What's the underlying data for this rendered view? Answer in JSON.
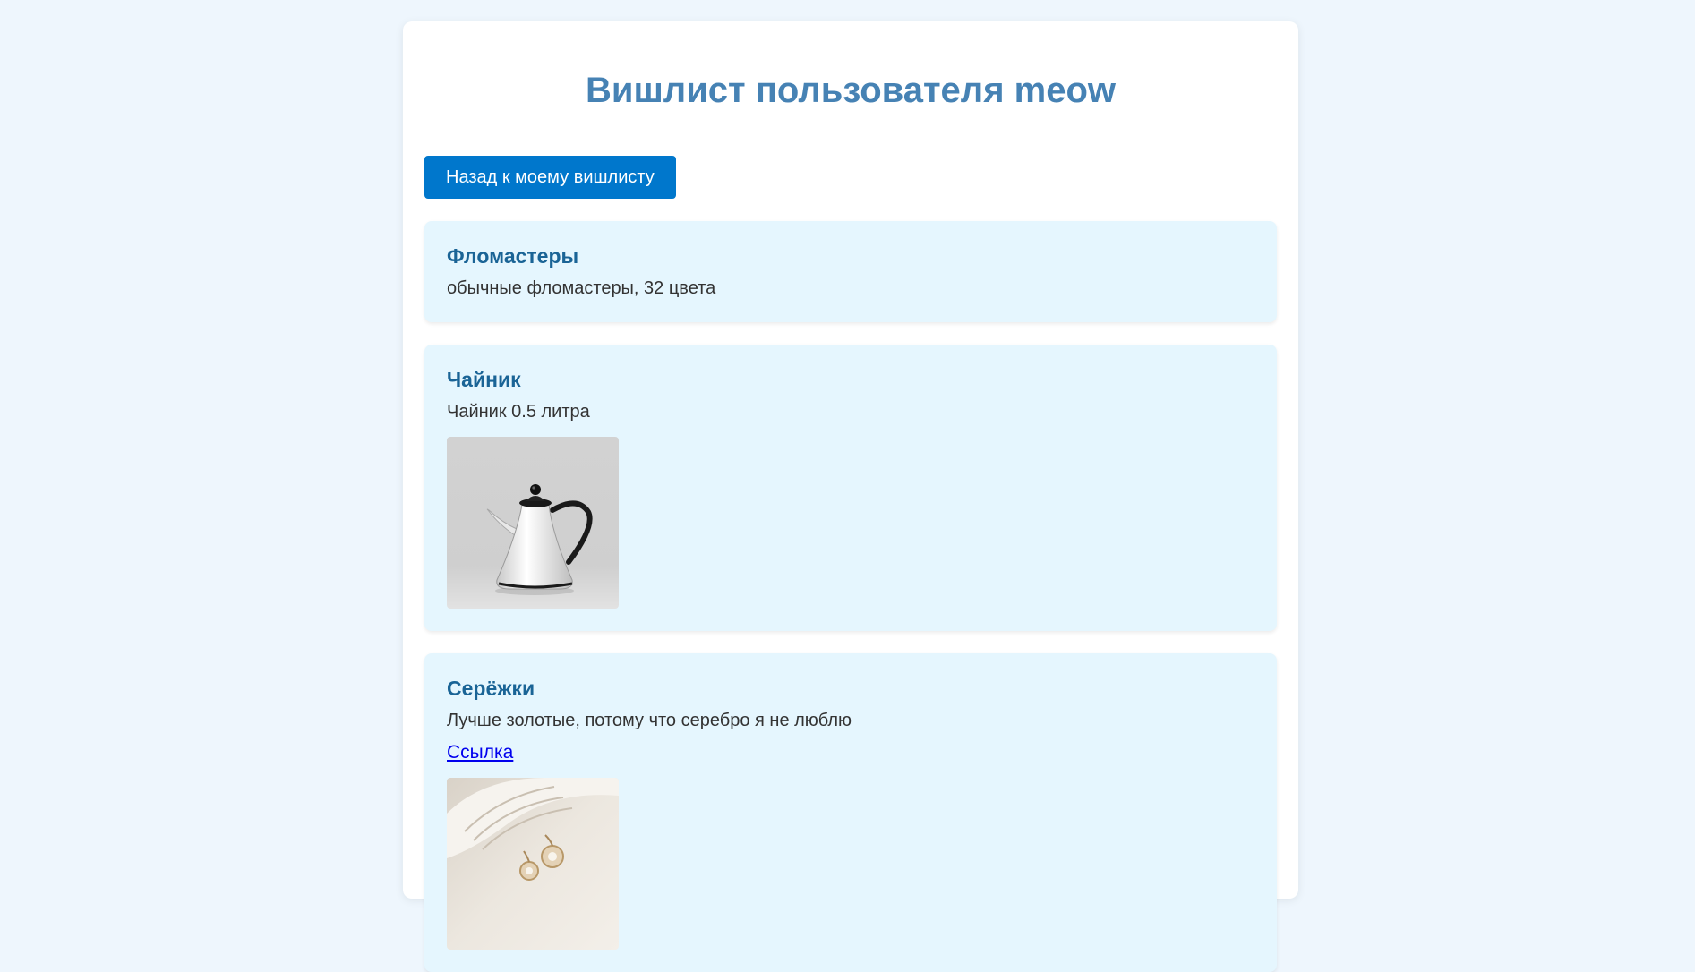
{
  "page": {
    "title": "Вишлист пользователя meow",
    "back_button_label": "Назад к моему вишлисту"
  },
  "items": [
    {
      "title": "Фломастеры",
      "description": "обычные фломастеры, 32 цвета"
    },
    {
      "title": "Чайник",
      "description": "Чайник 0.5 литра"
    },
    {
      "title": "Серёжки",
      "description": "Лучше золотые, потому что серебро я не люблю",
      "link_label": "Ссылка"
    }
  ],
  "colors": {
    "background": "#eef6fd",
    "title": "#4682b4",
    "button": "#0077cc",
    "card": "#e5f6fe",
    "item_title": "#1a6496",
    "link": "#0000ee"
  }
}
